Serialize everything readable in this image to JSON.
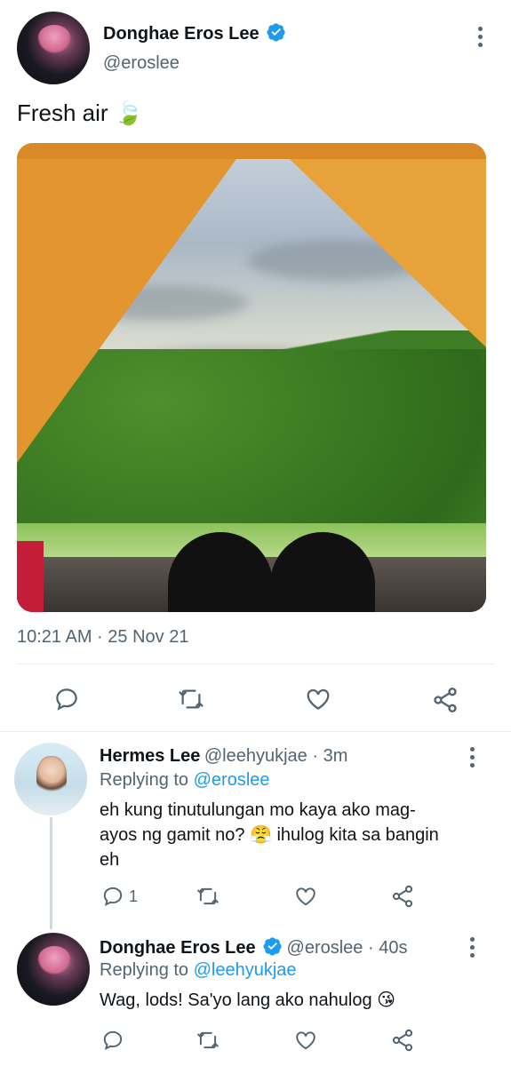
{
  "tweet": {
    "author_name": "Donghae Eros Lee",
    "author_handle": "@eroslee",
    "text": "Fresh air 🍃",
    "timestamp": "10:21 AM · 25 Nov 21"
  },
  "replies": [
    {
      "author_name": "Hermes Lee",
      "author_handle": "@leehyukjae",
      "time": "3m",
      "replying_prefix": "Replying to",
      "replying_to": "@eroslee",
      "text_line1": "eh kung tinutulungan mo kaya ako mag-",
      "text_line2": "ayos ng gamit no? 😤 ihulog kita sa bangin",
      "text_line3": "eh",
      "reply_count": "1"
    },
    {
      "author_name": "Donghae Eros Lee",
      "author_handle": "@eroslee",
      "time": "40s",
      "replying_prefix": "Replying to",
      "replying_to": "@leehyukjae",
      "text": "Wag, lods! Sa'yo lang ako nahulog 😘"
    }
  ],
  "icons": {
    "verified": "verified-badge-icon",
    "reply": "reply-icon",
    "retweet": "retweet-icon",
    "like": "like-icon",
    "share": "share-icon",
    "more": "more-icon"
  },
  "colors": {
    "accent": "#1d9bf0",
    "text": "#0f1419",
    "secondary": "#536471",
    "divider": "#e6ecf0"
  }
}
